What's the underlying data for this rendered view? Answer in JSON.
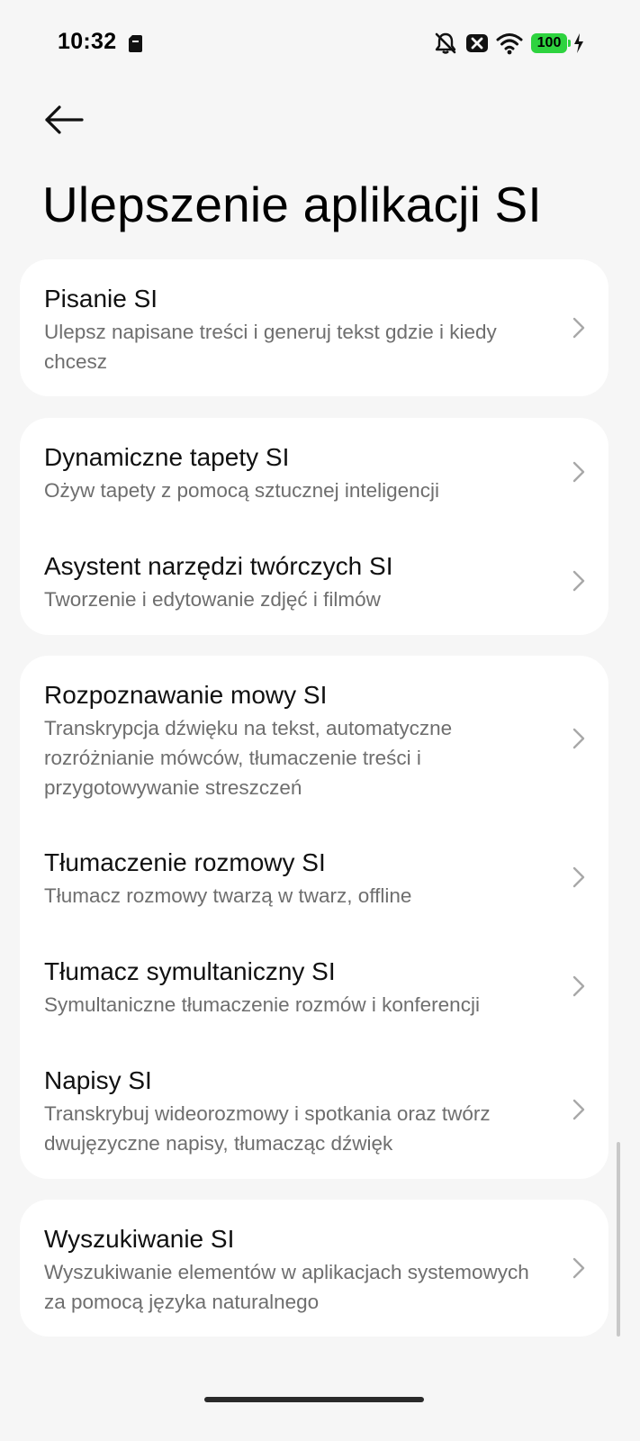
{
  "status_bar": {
    "time": "10:32",
    "battery_level": "100",
    "icons": [
      "sim-card-icon",
      "bell-off-icon",
      "data-off-icon",
      "wifi-icon",
      "battery-icon",
      "charging-icon"
    ]
  },
  "page": {
    "title": "Ulepszenie aplikacji SI",
    "back_icon": "arrow-left-icon"
  },
  "groups": [
    {
      "items": [
        {
          "title": "Pisanie SI",
          "subtitle": "Ulepsz napisane treści i generuj tekst gdzie i kiedy chcesz"
        }
      ]
    },
    {
      "items": [
        {
          "title": "Dynamiczne tapety SI",
          "subtitle": "Ożyw tapety z pomocą sztucznej inteligencji"
        },
        {
          "title": "Asystent narzędzi twórczych SI",
          "subtitle": "Tworzenie i edytowanie zdjęć i filmów"
        }
      ]
    },
    {
      "items": [
        {
          "title": "Rozpoznawanie mowy SI",
          "subtitle": "Transkrypcja dźwięku na tekst, automatyczne rozróżnianie mówców, tłumaczenie treści i przygotowywanie streszczeń"
        },
        {
          "title": "Tłumaczenie rozmowy SI",
          "subtitle": "Tłumacz rozmowy twarzą w twarz, offline"
        },
        {
          "title": "Tłumacz symultaniczny SI",
          "subtitle": "Symultaniczne tłumaczenie rozmów i konferencji"
        },
        {
          "title": "Napisy SI",
          "subtitle": "Transkrybuj wideorozmowy i spotkania oraz twórz dwujęzyczne napisy, tłumacząc dźwięk"
        }
      ]
    },
    {
      "items": [
        {
          "title": "Wyszukiwanie SI",
          "subtitle": "Wyszukiwanie elementów w aplikacjach systemowych za pomocą języka naturalnego"
        }
      ]
    }
  ],
  "chevron_icon": "chevron-right-icon"
}
